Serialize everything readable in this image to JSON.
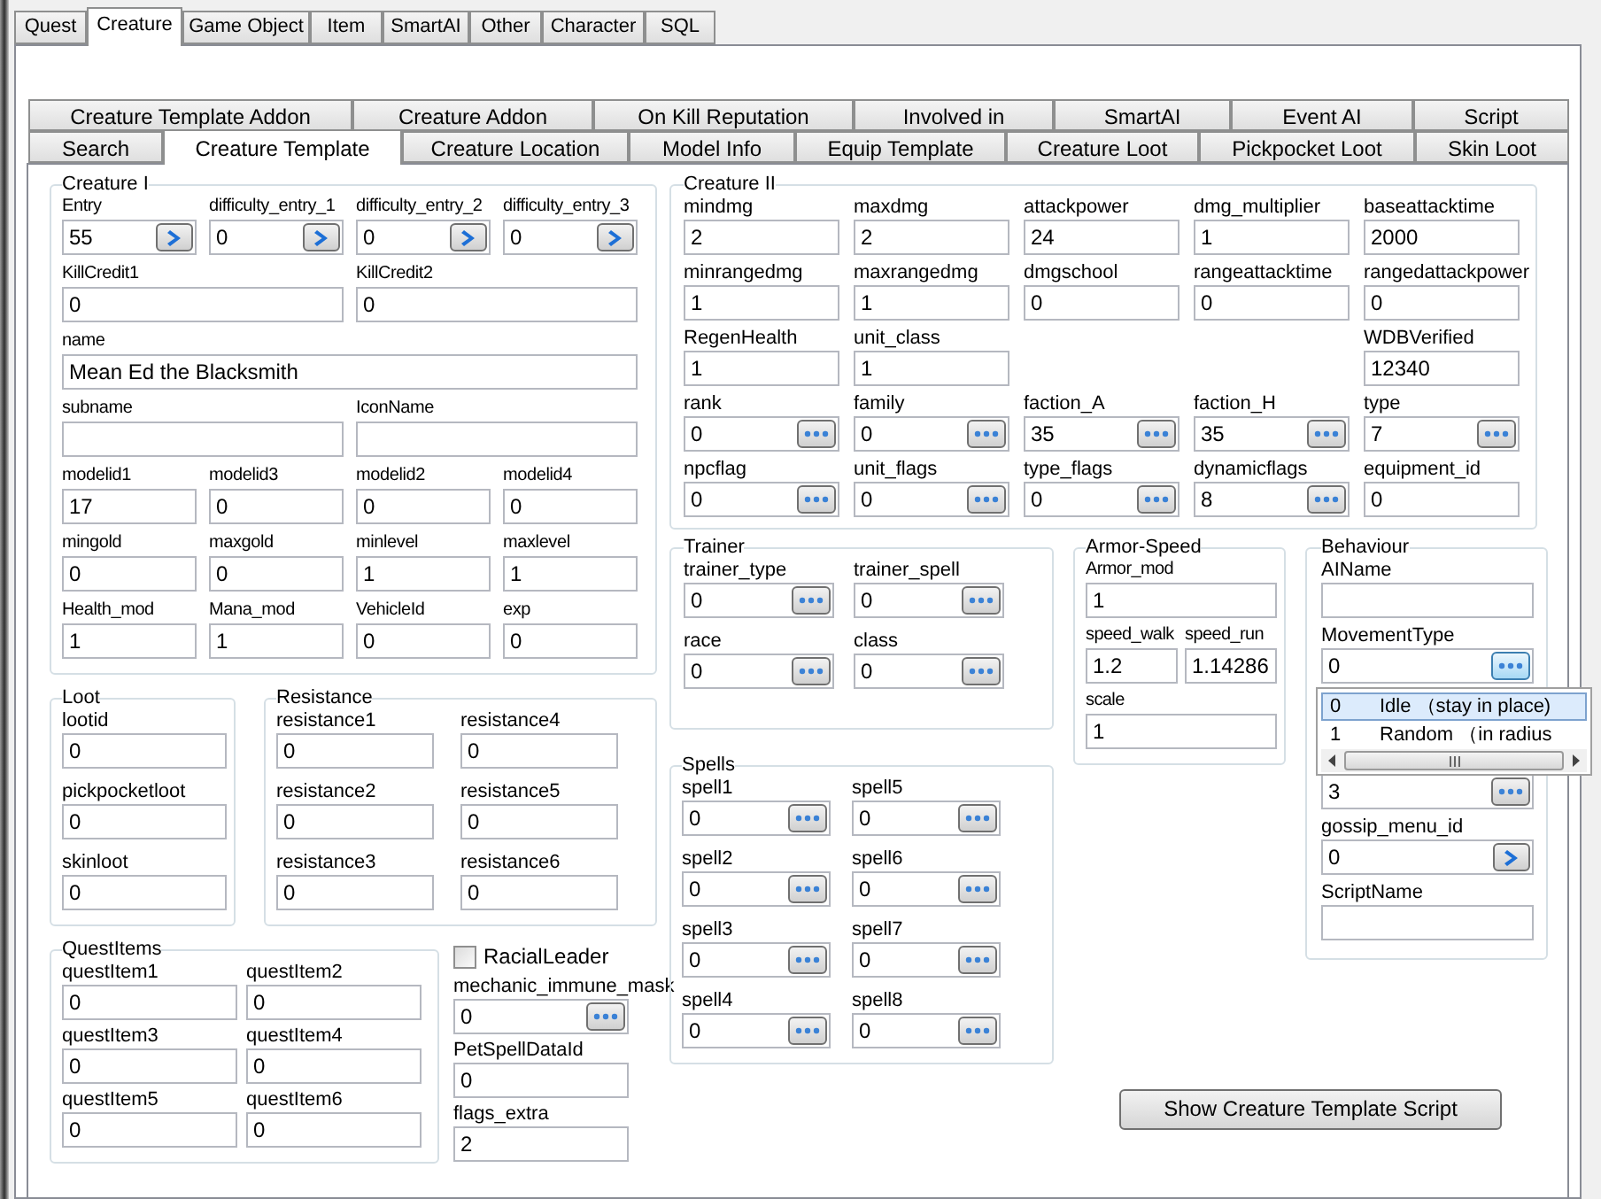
{
  "main_tabs": [
    {
      "label": "Quest",
      "selected": false
    },
    {
      "label": "Creature",
      "selected": true
    },
    {
      "label": "Game Object",
      "selected": false
    },
    {
      "label": "Item",
      "selected": false
    },
    {
      "label": "SmartAI",
      "selected": false
    },
    {
      "label": "Other",
      "selected": false
    },
    {
      "label": "Character",
      "selected": false
    },
    {
      "label": "SQL",
      "selected": false
    }
  ],
  "sub_tabs": [
    [
      {
        "label": "Creature Template Addon",
        "selected": false
      },
      {
        "label": "Creature Addon",
        "selected": false
      },
      {
        "label": "On Kill Reputation",
        "selected": false
      },
      {
        "label": "Involved in",
        "selected": false
      },
      {
        "label": "SmartAI",
        "selected": false
      },
      {
        "label": "Event AI",
        "selected": false
      },
      {
        "label": "Script",
        "selected": false
      }
    ],
    [
      {
        "label": "Search",
        "selected": false
      },
      {
        "label": "Creature Template",
        "selected": true
      },
      {
        "label": "Creature Location",
        "selected": false
      },
      {
        "label": "Model Info",
        "selected": false
      },
      {
        "label": "Equip Template",
        "selected": false
      },
      {
        "label": "Creature Loot",
        "selected": false
      },
      {
        "label": "Pickpocket Loot",
        "selected": false
      },
      {
        "label": "Skin Loot",
        "selected": false
      }
    ]
  ],
  "groups": {
    "creature_1": {
      "title": "Creature I",
      "rows": [
        [
          {
            "label": "Entry",
            "value": "55",
            "kind": "link"
          },
          {
            "label": "difficulty_entry_1",
            "value": "0",
            "kind": "link"
          },
          {
            "label": "difficulty_entry_2",
            "value": "0",
            "kind": "link"
          },
          {
            "label": "difficulty_entry_3",
            "value": "0",
            "kind": "link"
          }
        ],
        [
          {
            "label": "KillCredit1",
            "value": "0",
            "kind": "text"
          },
          {
            "label": "KillCredit2",
            "value": "0",
            "kind": "text"
          }
        ],
        [
          {
            "label": "name",
            "value": "Mean Ed the Blacksmith",
            "kind": "text"
          }
        ],
        [
          {
            "label": "subname",
            "kind": "text"
          },
          {
            "label": "IconName",
            "kind": "text"
          }
        ],
        [
          {
            "label": "modelid1",
            "value": "17",
            "kind": "text"
          },
          {
            "label": "modelid3",
            "value": "0",
            "kind": "text"
          },
          {
            "label": "modelid2",
            "value": "0",
            "kind": "text"
          },
          {
            "label": "modelid4",
            "value": "0",
            "kind": "text"
          }
        ],
        [
          {
            "label": "mingold",
            "value": "0",
            "kind": "text"
          },
          {
            "label": "maxgold",
            "value": "0",
            "kind": "text"
          },
          {
            "label": "minlevel",
            "value": "1",
            "kind": "text"
          },
          {
            "label": "maxlevel",
            "value": "1",
            "kind": "text"
          }
        ],
        [
          {
            "label": "Health_mod",
            "value": "1",
            "kind": "text"
          },
          {
            "label": "Mana_mod",
            "value": "1",
            "kind": "text"
          },
          {
            "label": "VehicleId",
            "value": "0",
            "kind": "text"
          },
          {
            "label": "exp",
            "value": "0",
            "kind": "text"
          }
        ]
      ]
    },
    "loot": {
      "title": "Loot",
      "rows": [
        [
          {
            "label": "lootid",
            "value": "0",
            "kind": "text"
          }
        ],
        [
          {
            "label": "pickpocketloot",
            "value": "0",
            "kind": "text"
          }
        ],
        [
          {
            "label": "skinloot",
            "value": "0",
            "kind": "text"
          }
        ]
      ]
    },
    "resistance": {
      "title": "Resistance",
      "rows": [
        [
          {
            "label": "resistance1",
            "value": "0",
            "kind": "text"
          },
          {
            "label": "resistance4",
            "value": "0",
            "kind": "text"
          }
        ],
        [
          {
            "label": "resistance2",
            "value": "0",
            "kind": "text"
          },
          {
            "label": "resistance5",
            "value": "0",
            "kind": "text"
          }
        ],
        [
          {
            "label": "resistance3",
            "value": "0",
            "kind": "text"
          },
          {
            "label": "resistance6",
            "value": "0",
            "kind": "text"
          }
        ]
      ]
    },
    "quest_items": {
      "title": "QuestItems",
      "rows": [
        [
          {
            "label": "questItem1",
            "value": "0",
            "kind": "text"
          },
          {
            "label": "questItem2",
            "value": "0",
            "kind": "text"
          }
        ],
        [
          {
            "label": "questItem3",
            "value": "0",
            "kind": "text"
          },
          {
            "label": "questItem4",
            "value": "0",
            "kind": "text"
          }
        ],
        [
          {
            "label": "questItem5",
            "value": "0",
            "kind": "text"
          },
          {
            "label": "questItem6",
            "value": "0",
            "kind": "text"
          }
        ]
      ]
    },
    "misc": {
      "rows": [
        [
          {
            "label": "RacialLeader",
            "kind": "checkbox",
            "checked": false
          }
        ],
        [
          {
            "label": "mechanic_immune_mask",
            "value": "0",
            "kind": "lookup"
          }
        ],
        [
          {
            "label": "PetSpellDataId",
            "value": "0",
            "kind": "text"
          }
        ],
        [
          {
            "label": "flags_extra",
            "value": "2",
            "kind": "text"
          }
        ]
      ]
    },
    "creature_2": {
      "title": "Creature II",
      "rows": [
        [
          {
            "label": "mindmg",
            "value": "2",
            "kind": "text"
          },
          {
            "label": "maxdmg",
            "value": "2",
            "kind": "text"
          },
          {
            "label": "attackpower",
            "value": "24",
            "kind": "text"
          },
          {
            "label": "dmg_multiplier",
            "value": "1",
            "kind": "text"
          },
          {
            "label": "baseattacktime",
            "value": "2000",
            "kind": "text"
          }
        ],
        [
          {
            "label": "minrangedmg",
            "value": "1",
            "kind": "text"
          },
          {
            "label": "maxrangedmg",
            "value": "1",
            "kind": "text"
          },
          {
            "label": "dmgschool",
            "value": "0",
            "kind": "text"
          },
          {
            "label": "rangeattacktime",
            "value": "0",
            "kind": "text"
          },
          {
            "label": "rangedattackpower",
            "value": "0",
            "kind": "text"
          }
        ],
        [
          {
            "label": "RegenHealth",
            "value": "1",
            "kind": "text"
          },
          {
            "label": "unit_class",
            "value": "1",
            "kind": "text"
          },
          "",
          "",
          {
            "label": "WDBVerified",
            "value": "12340",
            "kind": "text"
          }
        ],
        [
          {
            "label": "rank",
            "value": "0",
            "kind": "lookup"
          },
          {
            "label": "family",
            "value": "0",
            "kind": "lookup"
          },
          {
            "label": "faction_A",
            "value": "35",
            "kind": "lookup"
          },
          {
            "label": "faction_H",
            "value": "35",
            "kind": "lookup"
          },
          {
            "label": "type",
            "value": "7",
            "kind": "lookup"
          }
        ],
        [
          {
            "label": "npcflag",
            "value": "0",
            "kind": "lookup"
          },
          {
            "label": "unit_flags",
            "value": "0",
            "kind": "lookup"
          },
          {
            "label": "type_flags",
            "value": "0",
            "kind": "lookup"
          },
          {
            "label": "dynamicflags",
            "value": "8",
            "kind": "lookup"
          },
          {
            "label": "equipment_id",
            "value": "0",
            "kind": "text"
          }
        ]
      ]
    },
    "trainer": {
      "title": "Trainer",
      "rows": [
        [
          {
            "label": "trainer_type",
            "value": "0",
            "kind": "lookup"
          },
          {
            "label": "trainer_spell",
            "value": "0",
            "kind": "lookup"
          }
        ],
        [
          {
            "label": "race",
            "value": "0",
            "kind": "lookup"
          },
          {
            "label": "class",
            "value": "0",
            "kind": "lookup"
          }
        ]
      ]
    },
    "spells": {
      "title": "Spells",
      "rows": [
        [
          {
            "label": "spell1",
            "value": "0",
            "kind": "lookup"
          },
          {
            "label": "spell5",
            "value": "0",
            "kind": "lookup"
          }
        ],
        [
          {
            "label": "spell2",
            "value": "0",
            "kind": "lookup"
          },
          {
            "label": "spell6",
            "value": "0",
            "kind": "lookup"
          }
        ],
        [
          {
            "label": "spell3",
            "value": "0",
            "kind": "lookup"
          },
          {
            "label": "spell7",
            "value": "0",
            "kind": "lookup"
          }
        ],
        [
          {
            "label": "spell4",
            "value": "0",
            "kind": "lookup"
          },
          {
            "label": "spell8",
            "value": "0",
            "kind": "lookup"
          }
        ]
      ]
    },
    "armor_speed": {
      "title": "Armor-Speed",
      "rows": [
        [
          {
            "label": "Armor_mod",
            "value": "1",
            "kind": "text"
          }
        ],
        [
          {
            "label": "speed_walk",
            "value": "1.2",
            "kind": "text"
          },
          {
            "label": "speed_run",
            "value": "1.14286",
            "kind": "text"
          }
        ],
        [
          {
            "label": "scale",
            "value": "1",
            "kind": "text"
          }
        ]
      ]
    },
    "behaviour": {
      "title": "Behaviour",
      "rows": [
        [
          {
            "label": "AIName",
            "kind": "text"
          }
        ],
        [
          {
            "label": "MovementType",
            "value": "0",
            "kind": "lookup",
            "dropdown": {
              "items": [
                {
                  "code": "0",
                  "text": "Idle （stay in place)",
                  "selected": true
                },
                {
                  "code": "1",
                  "text": "Random （in radius",
                  "selected": false
                }
              ]
            }
          }
        ],
        [
          {
            "value": "3",
            "kind": "lookup"
          }
        ],
        [
          {
            "label": "gossip_menu_id",
            "value": "0",
            "kind": "link"
          }
        ],
        [
          {
            "label": "ScriptName",
            "kind": "text"
          }
        ]
      ]
    }
  },
  "script_button": "Show Creature Template Script"
}
